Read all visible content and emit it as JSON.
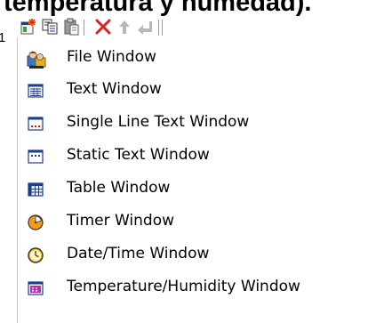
{
  "background": {
    "heading": "temperatura y humedad).",
    "side_text": "1"
  },
  "toolbar": {
    "buttons": [
      {
        "icon": "new-window-icon"
      },
      {
        "icon": "copy-icon"
      },
      {
        "icon": "paste-icon"
      },
      {
        "icon": "delete-icon"
      },
      {
        "icon": "move-up-icon"
      },
      {
        "icon": "move-down-icon"
      }
    ]
  },
  "menu": {
    "items": [
      {
        "label": "File Window",
        "icon": "file-window-icon"
      },
      {
        "label": "Text Window",
        "icon": "text-window-icon"
      },
      {
        "label": "Single Line Text Window",
        "icon": "single-line-text-window-icon"
      },
      {
        "label": "Static Text Window",
        "icon": "static-text-window-icon"
      },
      {
        "label": "Table Window",
        "icon": "table-window-icon"
      },
      {
        "label": "Timer Window",
        "icon": "timer-window-icon"
      },
      {
        "label": "Date/Time Window",
        "icon": "date-time-window-icon"
      },
      {
        "label": "Temperature/Humidity Window",
        "icon": "temperature-humidity-window-icon"
      }
    ]
  },
  "colors": {
    "delete_red": "#e02020",
    "arrow_gray": "#b8b8b8",
    "window_blue": "#1a3d8f",
    "accent_red": "#d81818",
    "timer_orange": "#f39a1a",
    "clock_yellow": "#f4c51d",
    "temp_magenta": "#c02ab0"
  }
}
